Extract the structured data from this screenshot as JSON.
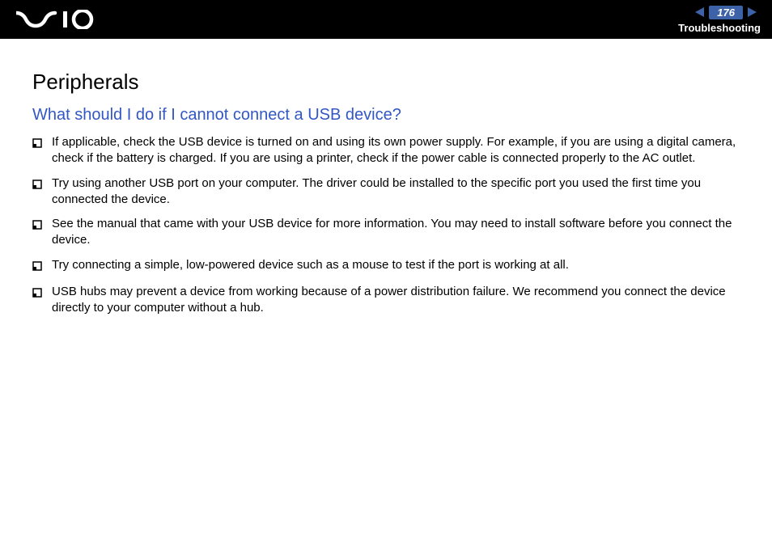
{
  "header": {
    "page_number": "176",
    "section": "Troubleshooting"
  },
  "content": {
    "title": "Peripherals",
    "question": "What should I do if I cannot connect a USB device?",
    "bullets": [
      "If applicable, check the USB device is turned on and using its own power supply. For example, if you are using a digital camera, check if the battery is charged. If you are using a printer, check if the power cable is connected properly to the AC outlet.",
      "Try using another USB port on your computer. The driver could be installed to the specific port you used the first time you connected the device.",
      "See the manual that came with your USB device for more information. You may need to install software before you connect the device.",
      "Try connecting a simple, low-powered device such as a mouse to test if the port is working at all.",
      "USB hubs may prevent a device from working because of a power distribution failure. We recommend you connect the device directly to your computer without a hub."
    ]
  }
}
